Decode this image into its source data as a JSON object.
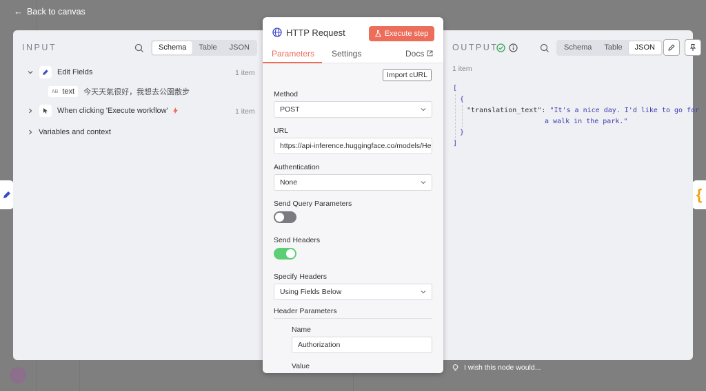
{
  "nav": {
    "back_label": "Back to canvas"
  },
  "input": {
    "title": "INPUT",
    "view_tabs": [
      "Schema",
      "Table",
      "JSON"
    ],
    "active_tab": "Schema",
    "tree": [
      {
        "label": "Edit Fields",
        "count": "1 item",
        "expanded": true,
        "fields": [
          {
            "type": "AB",
            "name": "text",
            "value": "今天天氣很好，我想去公園散步"
          }
        ]
      },
      {
        "label": "When clicking 'Execute workflow'",
        "count": "1 item",
        "expanded": false
      }
    ],
    "variables_label": "Variables and context"
  },
  "node": {
    "title": "HTTP Request",
    "execute_label": "Execute step",
    "tabs": {
      "parameters": "Parameters",
      "settings": "Settings",
      "docs": "Docs"
    },
    "import_curl": "Import cURL",
    "method": {
      "label": "Method",
      "value": "POST"
    },
    "url": {
      "label": "URL",
      "value": "https://api-inference.huggingface.co/models/Hel"
    },
    "authentication": {
      "label": "Authentication",
      "value": "None"
    },
    "send_query": {
      "label": "Send Query Parameters",
      "on": false
    },
    "send_headers": {
      "label": "Send Headers",
      "on": true
    },
    "specify_headers": {
      "label": "Specify Headers",
      "value": "Using Fields Below"
    },
    "header_params": {
      "label": "Header Parameters",
      "name_label": "Name",
      "name_value": "Authorization",
      "value_label": "Value"
    }
  },
  "output": {
    "title": "OUTPUT",
    "view_tabs": [
      "Schema",
      "Table",
      "JSON"
    ],
    "active_tab": "JSON",
    "count": "1 item",
    "json_key": "\"translation_text\":",
    "json_value_line1": "\"It's a nice day. I'd like to go for",
    "json_value_line2": "a walk in the park.\""
  },
  "feedback": {
    "label": "I wish this node would..."
  },
  "colors": {
    "accent": "#ec6d5a",
    "toggle_on": "#5ccf74",
    "toggle_off": "#7a7a80",
    "json_text": "#3b3bb0"
  }
}
